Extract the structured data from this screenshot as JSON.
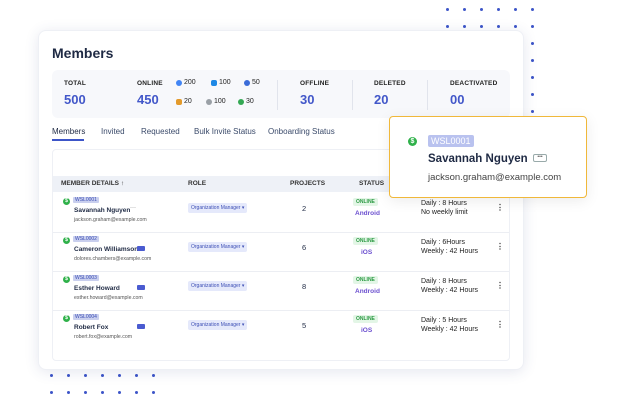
{
  "page": {
    "title": "Members"
  },
  "stats": {
    "total": {
      "label": "TOTAL",
      "value": "500"
    },
    "online": {
      "label": "ONLINE",
      "value": "450",
      "platforms": [
        {
          "icon": "chrome-icon",
          "value": "200",
          "color": "#4285f4"
        },
        {
          "icon": "windows-icon",
          "value": "100",
          "color": "#1e88e5"
        },
        {
          "icon": "ubuntu-icon",
          "value": "50",
          "color": "#3b6cd8"
        },
        {
          "icon": "linux-icon",
          "value": "20",
          "color": "#e39a2b"
        },
        {
          "icon": "apple-icon",
          "value": "100",
          "color": "#9aa0a6"
        },
        {
          "icon": "android-icon",
          "value": "30",
          "color": "#34a853"
        }
      ]
    },
    "offline": {
      "label": "OFFLINE",
      "value": "30"
    },
    "deleted": {
      "label": "DELETED",
      "value": "20"
    },
    "deactivated": {
      "label": "DEACTIVATED",
      "value": "00"
    }
  },
  "tabs": [
    "Members",
    "Invited",
    "Requested",
    "Bulk Invite Status",
    "Onboarding Status"
  ],
  "table": {
    "headers": {
      "member": "MEMBER DETAILS ↑",
      "role": "ROLE",
      "projects": "PROJECTS",
      "status": "STATUS"
    },
    "rows": [
      {
        "code": "WSL0001",
        "name": "Savannah Nguyen",
        "email": "jackson.graham@example.com",
        "role": "Organization Manager ▾",
        "projects": "2",
        "status": "ONLINE",
        "os": "Android",
        "daily": "Daily : 8 Hours",
        "weekly": "No weekly limit",
        "badge": "···"
      },
      {
        "code": "WSL0002",
        "name": "Cameron Williamson",
        "email": "dolores.chambers@example.com",
        "role": "Organization Manager ▾",
        "projects": "6",
        "status": "ONLINE",
        "os": "iOS",
        "daily": "Daily : 6Hours",
        "weekly": "Weekly : 42 Hours",
        "badge": ""
      },
      {
        "code": "WSL0003",
        "name": "Esther Howard",
        "email": "esther.howard@example.com",
        "role": "Organization Manager ▾",
        "projects": "8",
        "status": "ONLINE",
        "os": "Android",
        "daily": "Daily : 8 Hours",
        "weekly": "Weekly : 42 Hours",
        "badge": ""
      },
      {
        "code": "WSL0004",
        "name": "Robert Fox",
        "email": "robert.fox@example.com",
        "role": "Organization Manager ▾",
        "projects": "5",
        "status": "ONLINE",
        "os": "iOS",
        "daily": "Daily : 5 Hours",
        "weekly": "Weekly : 42 Hours",
        "badge": ""
      }
    ]
  },
  "popup": {
    "code": "WSL0001",
    "name": "Savannah Nguyen",
    "badge": "•••",
    "email": "jackson.graham@example.com"
  },
  "colors": {
    "accent": "#3d55c8",
    "popup_border": "#f0b83a",
    "online": "#2c9a44",
    "os": "#6b4fcf"
  }
}
